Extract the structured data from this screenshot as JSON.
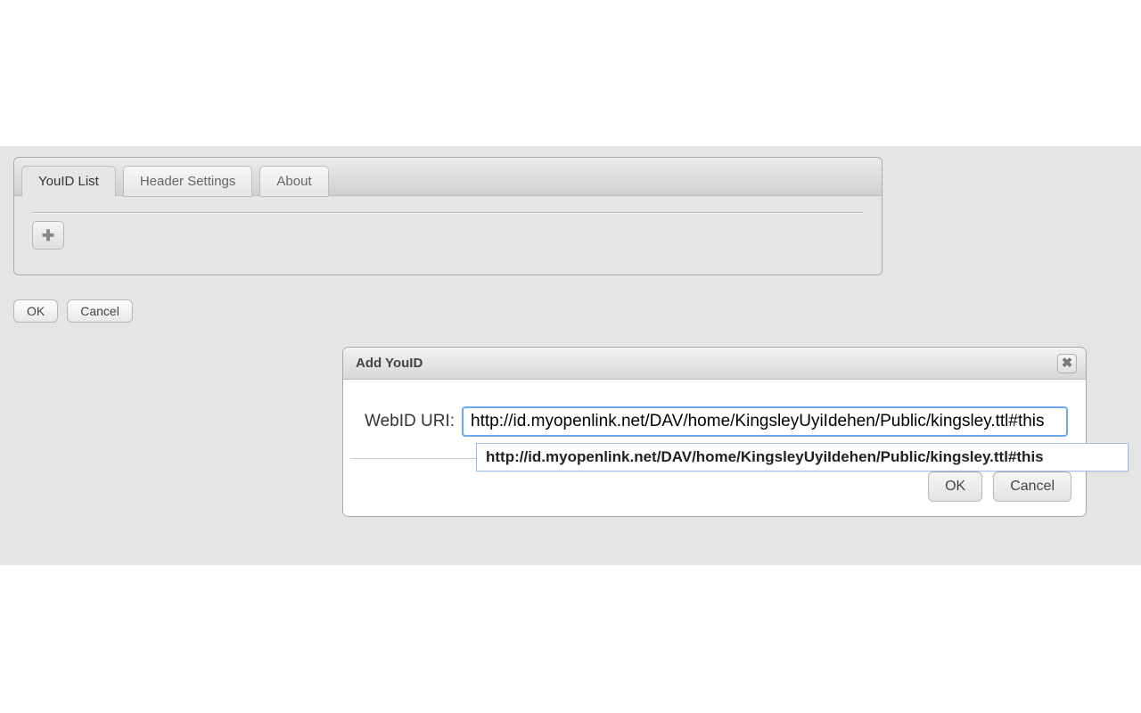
{
  "tabs": [
    {
      "label": "YouID List",
      "active": true
    },
    {
      "label": "Header Settings",
      "active": false
    },
    {
      "label": "About",
      "active": false
    }
  ],
  "toolbar": {
    "add_icon": "plus-icon"
  },
  "main_actions": {
    "ok": "OK",
    "cancel": "Cancel"
  },
  "dialog": {
    "title": "Add YouID",
    "field_label": "WebID URI:",
    "input_value": "http://id.myopenlink.net/DAV/home/KingsleyUyiIdehen/Public/kingsley.ttl#this",
    "ok": "OK",
    "cancel": "Cancel"
  },
  "autocomplete": {
    "suggestion": "http://id.myopenlink.net/DAV/home/KingsleyUyiIdehen/Public/kingsley.ttl#this"
  }
}
